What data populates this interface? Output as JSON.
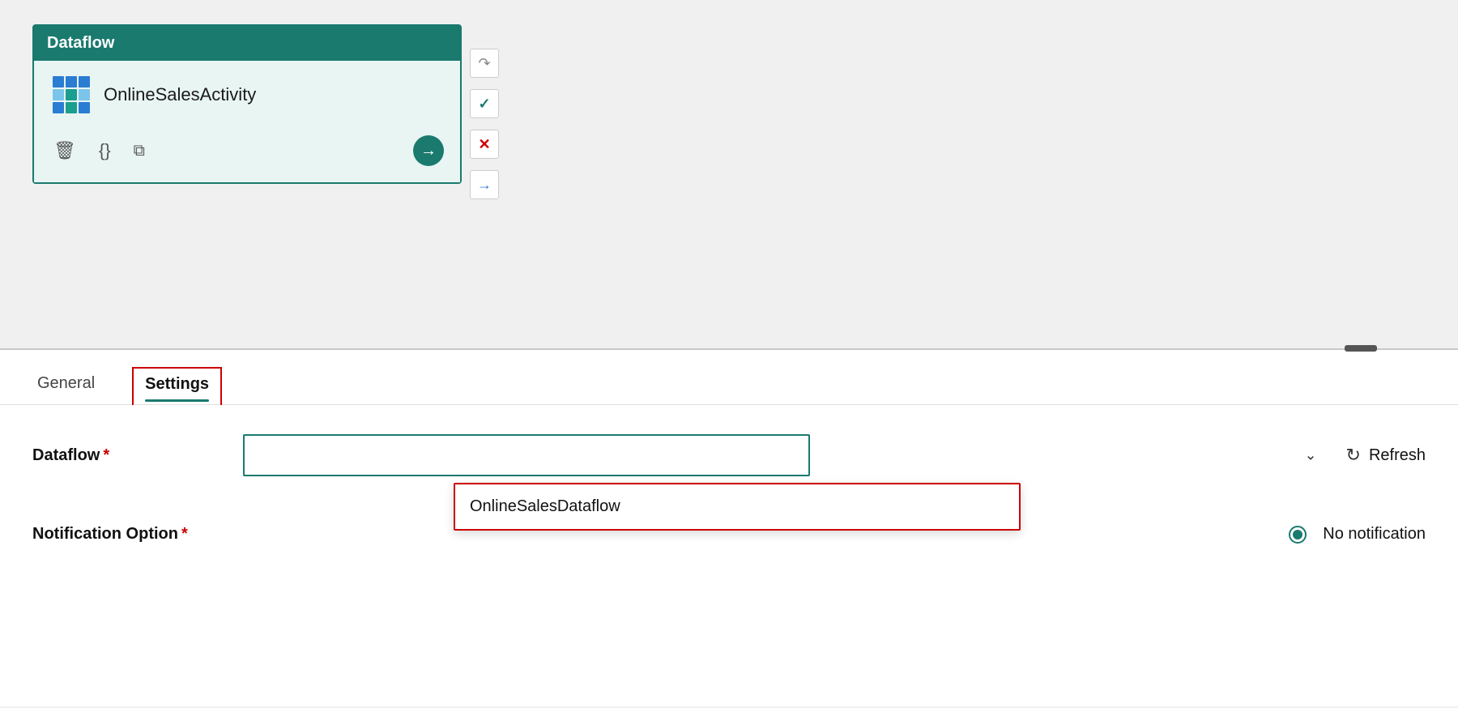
{
  "canvas": {
    "card": {
      "header": "Dataflow",
      "activity_name": "OnlineSalesActivity",
      "actions": {
        "delete_icon": "🗑",
        "braces_icon": "{}",
        "copy_icon": "⧉",
        "arrow_icon": "→"
      }
    },
    "side_icons": {
      "redo": "↷",
      "check": "✓",
      "close": "✕",
      "arrow": "→"
    }
  },
  "settings_panel": {
    "tabs": [
      {
        "label": "General",
        "active": false
      },
      {
        "label": "Settings",
        "active": true
      }
    ],
    "form": {
      "dataflow_label": "Dataflow",
      "dataflow_required": "*",
      "dataflow_dropdown_value": "",
      "dataflow_placeholder": "",
      "dropdown_chevron": "⌄",
      "dropdown_option": "OnlineSalesDataflow",
      "refresh_label": "Refresh",
      "notification_label": "Notification Option",
      "notification_required": "*",
      "no_notification_label": "No notification"
    }
  }
}
